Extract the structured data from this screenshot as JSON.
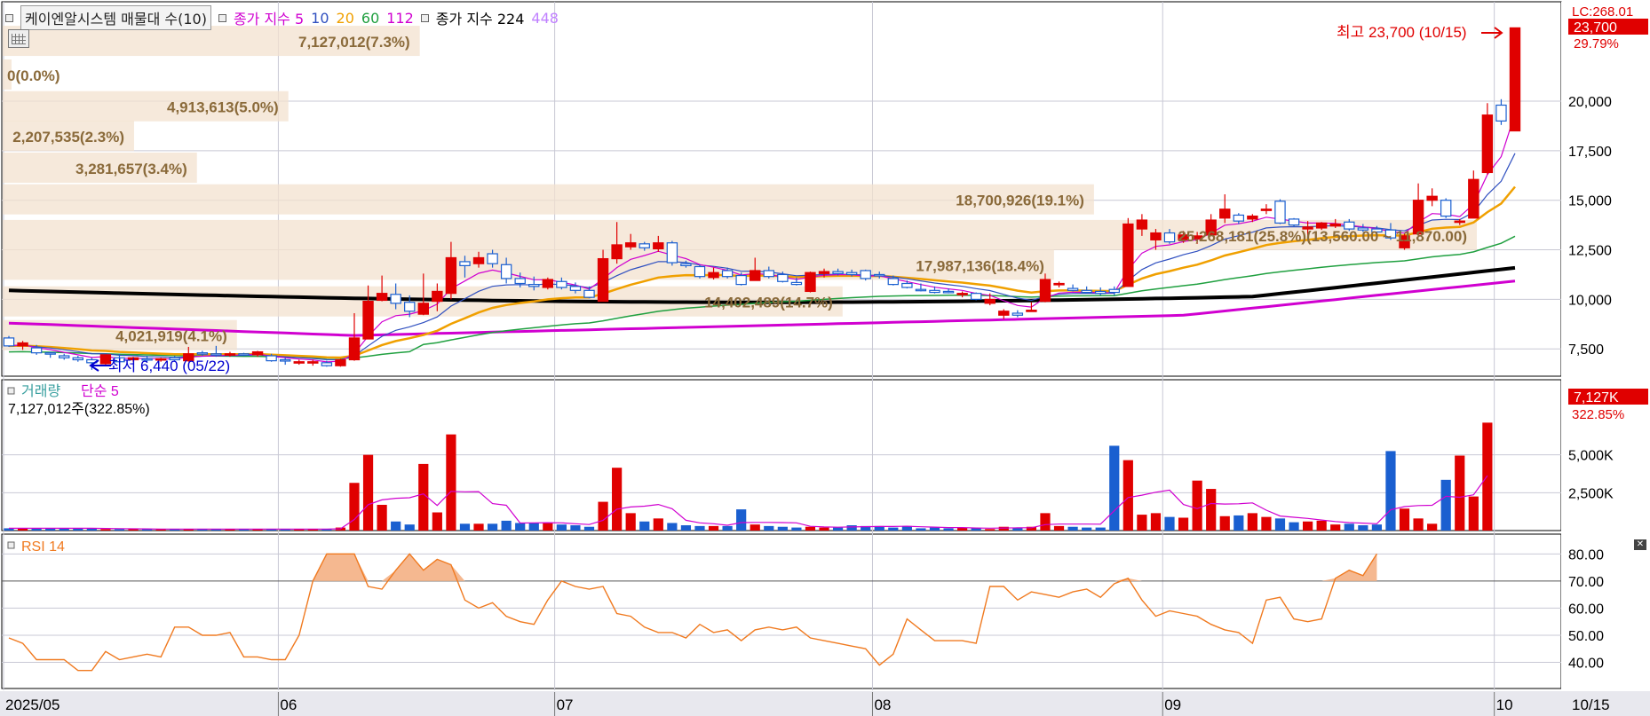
{
  "header": {
    "stock_name": "케이엔알시스템 매물대 수(10)",
    "ma_label": "종가 지수 5",
    "ma_periods": [
      "10",
      "20",
      "60",
      "112"
    ],
    "ma_colors": [
      "#d000d0",
      "#3050c0",
      "#f0a000",
      "#20a040",
      "#d000d0"
    ],
    "ma2_label": "종가 지수 224",
    "ma2_extra": "448",
    "ma2_extra_color": "#c080ff"
  },
  "price_panel": {
    "lc_label": "LC:268.01",
    "current_price": "23,700",
    "current_change": "29.79%",
    "high_annotation": "최고 23,700 (10/15)",
    "low_annotation": "최저 6,440 (05/22)",
    "y_ticks": [
      "20,000",
      "17,500",
      "15,000",
      "12,500",
      "10,000",
      "7,500"
    ],
    "y_tick_values": [
      20000,
      17500,
      15000,
      12500,
      10000,
      7500
    ]
  },
  "volume_profile": [
    {
      "label": "7,127,012(7.3%)",
      "price": 23000
    },
    {
      "label": "0(0.0%)",
      "price": 21300
    },
    {
      "label": "4,913,613(5.0%)",
      "price": 19700
    },
    {
      "label": "2,207,535(2.3%)",
      "price": 18200
    },
    {
      "label": "3,281,657(3.4%)",
      "price": 16600
    },
    {
      "label": "18,700,926(19.1%)",
      "price": 15000
    },
    {
      "label": "25,268,181(25.8%)(13,560.00 ~ 11,870.00)",
      "price": 13200
    },
    {
      "label": "17,987,136(18.4%)",
      "price": 11700
    },
    {
      "label": "14,402,489(14.7%)",
      "price": 9850
    },
    {
      "label": "4,021,919(4.1%)",
      "price": 8150
    }
  ],
  "volume_panel": {
    "title": "거래량",
    "ma_label": "단순 5",
    "info": "7,127,012주(322.85%)",
    "current_value": "7,127K",
    "current_pct": "322.85%",
    "y_ticks": [
      "5,000K",
      "2,500K"
    ],
    "y_tick_values": [
      5000,
      2500
    ]
  },
  "rsi_panel": {
    "title": "RSI 14",
    "y_ticks": [
      "80.00",
      "70.00",
      "60.00",
      "50.00",
      "40.00"
    ],
    "y_tick_values": [
      80,
      70,
      60,
      50,
      40
    ],
    "signal_line": 70
  },
  "x_axis": {
    "labels": [
      "2025/05",
      "06",
      "07",
      "08",
      "09",
      "10",
      "10/15"
    ]
  },
  "chart_data": {
    "type": "candlestick",
    "title": "케이엔알시스템",
    "xlabel": "",
    "ylabel": "",
    "price_ylim": [
      6300,
      24300
    ],
    "volume_ylim": [
      0,
      7500
    ],
    "rsi_ylim": [
      31,
      86
    ],
    "grid": true,
    "candles": [
      {
        "o": 8050,
        "h": 8150,
        "l": 7600,
        "c": 7650
      },
      {
        "o": 7650,
        "h": 7900,
        "l": 7450,
        "c": 7800
      },
      {
        "o": 7550,
        "h": 7700,
        "l": 7200,
        "c": 7300
      },
      {
        "o": 7300,
        "h": 7350,
        "l": 7050,
        "c": 7250
      },
      {
        "o": 7150,
        "h": 7250,
        "l": 6950,
        "c": 7050
      },
      {
        "o": 7050,
        "h": 7150,
        "l": 6850,
        "c": 6950
      },
      {
        "o": 6950,
        "h": 7050,
        "l": 6440,
        "c": 6800
      },
      {
        "o": 6750,
        "h": 7200,
        "l": 6700,
        "c": 7200
      },
      {
        "o": 7050,
        "h": 7250,
        "l": 6800,
        "c": 6850
      },
      {
        "o": 6950,
        "h": 7100,
        "l": 6850,
        "c": 7050
      },
      {
        "o": 7000,
        "h": 7150,
        "l": 6850,
        "c": 6950
      },
      {
        "o": 6950,
        "h": 7050,
        "l": 6850,
        "c": 7000
      },
      {
        "o": 7050,
        "h": 7150,
        "l": 6900,
        "c": 6950
      },
      {
        "o": 6900,
        "h": 7600,
        "l": 6850,
        "c": 7250
      },
      {
        "o": 7300,
        "h": 7400,
        "l": 7150,
        "c": 7250
      },
      {
        "o": 7250,
        "h": 7650,
        "l": 7100,
        "c": 7200
      },
      {
        "o": 7200,
        "h": 7350,
        "l": 7100,
        "c": 7250
      },
      {
        "o": 7250,
        "h": 7300,
        "l": 7150,
        "c": 7200
      },
      {
        "o": 7200,
        "h": 7400,
        "l": 7100,
        "c": 7350
      },
      {
        "o": 7150,
        "h": 7250,
        "l": 6850,
        "c": 6900
      },
      {
        "o": 6950,
        "h": 7050,
        "l": 6700,
        "c": 6900
      },
      {
        "o": 6850,
        "h": 6950,
        "l": 6700,
        "c": 6850
      },
      {
        "o": 6850,
        "h": 6950,
        "l": 6650,
        "c": 6850
      },
      {
        "o": 6800,
        "h": 6900,
        "l": 6600,
        "c": 6650
      },
      {
        "o": 6650,
        "h": 7000,
        "l": 6600,
        "c": 6950
      },
      {
        "o": 6950,
        "h": 9300,
        "l": 6900,
        "c": 8050
      },
      {
        "o": 8000,
        "h": 10700,
        "l": 8000,
        "c": 9900
      },
      {
        "o": 9950,
        "h": 11200,
        "l": 9900,
        "c": 10300
      },
      {
        "o": 10250,
        "h": 10800,
        "l": 9500,
        "c": 9800
      },
      {
        "o": 9850,
        "h": 10200,
        "l": 9100,
        "c": 9400
      },
      {
        "o": 9250,
        "h": 11300,
        "l": 9200,
        "c": 9800
      },
      {
        "o": 9900,
        "h": 10800,
        "l": 9400,
        "c": 10400
      },
      {
        "o": 10300,
        "h": 12900,
        "l": 10000,
        "c": 12100
      },
      {
        "o": 11900,
        "h": 12200,
        "l": 11100,
        "c": 11700
      },
      {
        "o": 11800,
        "h": 12400,
        "l": 11600,
        "c": 12100
      },
      {
        "o": 12300,
        "h": 12500,
        "l": 11600,
        "c": 11800
      },
      {
        "o": 11750,
        "h": 12100,
        "l": 10800,
        "c": 11050
      },
      {
        "o": 11050,
        "h": 11350,
        "l": 10600,
        "c": 10800
      },
      {
        "o": 10750,
        "h": 11150,
        "l": 10450,
        "c": 10650
      },
      {
        "o": 10600,
        "h": 11100,
        "l": 10500,
        "c": 11000
      },
      {
        "o": 10900,
        "h": 11100,
        "l": 10500,
        "c": 10600
      },
      {
        "o": 10650,
        "h": 10850,
        "l": 10300,
        "c": 10450
      },
      {
        "o": 10450,
        "h": 10650,
        "l": 10050,
        "c": 10100
      },
      {
        "o": 9900,
        "h": 12500,
        "l": 9900,
        "c": 12050
      },
      {
        "o": 12050,
        "h": 13900,
        "l": 11800,
        "c": 12750
      },
      {
        "o": 12650,
        "h": 13300,
        "l": 12500,
        "c": 12850
      },
      {
        "o": 12800,
        "h": 12900,
        "l": 12450,
        "c": 12600
      },
      {
        "o": 12550,
        "h": 13200,
        "l": 12400,
        "c": 12850
      },
      {
        "o": 12850,
        "h": 12950,
        "l": 11700,
        "c": 11850
      },
      {
        "o": 11800,
        "h": 11950,
        "l": 11600,
        "c": 11700
      },
      {
        "o": 11650,
        "h": 11750,
        "l": 11050,
        "c": 11150
      },
      {
        "o": 11100,
        "h": 11600,
        "l": 11000,
        "c": 11350
      },
      {
        "o": 11450,
        "h": 11600,
        "l": 11050,
        "c": 11150
      },
      {
        "o": 11200,
        "h": 11350,
        "l": 10700,
        "c": 10750
      },
      {
        "o": 10950,
        "h": 12100,
        "l": 10950,
        "c": 11450
      },
      {
        "o": 11450,
        "h": 11650,
        "l": 11050,
        "c": 11150
      },
      {
        "o": 11250,
        "h": 11400,
        "l": 10850,
        "c": 10900
      },
      {
        "o": 10850,
        "h": 11100,
        "l": 10700,
        "c": 10750
      },
      {
        "o": 10400,
        "h": 11400,
        "l": 10350,
        "c": 11350
      },
      {
        "o": 11300,
        "h": 11550,
        "l": 11100,
        "c": 11400
      },
      {
        "o": 11400,
        "h": 11550,
        "l": 11200,
        "c": 11300
      },
      {
        "o": 11350,
        "h": 11500,
        "l": 11150,
        "c": 11250
      },
      {
        "o": 11450,
        "h": 11500,
        "l": 10950,
        "c": 11050
      },
      {
        "o": 11250,
        "h": 11400,
        "l": 11050,
        "c": 11200
      },
      {
        "o": 11050,
        "h": 11200,
        "l": 10700,
        "c": 10750
      },
      {
        "o": 10800,
        "h": 10950,
        "l": 10550,
        "c": 10600
      },
      {
        "o": 10500,
        "h": 10800,
        "l": 10400,
        "c": 10450
      },
      {
        "o": 10450,
        "h": 10650,
        "l": 10300,
        "c": 10350
      },
      {
        "o": 10400,
        "h": 10550,
        "l": 10300,
        "c": 10350
      },
      {
        "o": 10300,
        "h": 10400,
        "l": 10100,
        "c": 10300
      },
      {
        "o": 10300,
        "h": 10350,
        "l": 9950,
        "c": 10000
      },
      {
        "o": 9800,
        "h": 10300,
        "l": 9700,
        "c": 10000
      },
      {
        "o": 9200,
        "h": 9500,
        "l": 9000,
        "c": 9400
      },
      {
        "o": 9300,
        "h": 9450,
        "l": 9100,
        "c": 9200
      },
      {
        "o": 9450,
        "h": 9850,
        "l": 9400,
        "c": 9450
      },
      {
        "o": 9900,
        "h": 11300,
        "l": 9850,
        "c": 11000
      },
      {
        "o": 10750,
        "h": 10900,
        "l": 10600,
        "c": 10800
      },
      {
        "o": 10550,
        "h": 10750,
        "l": 10400,
        "c": 10450
      },
      {
        "o": 10450,
        "h": 10650,
        "l": 10300,
        "c": 10350
      },
      {
        "o": 10400,
        "h": 10600,
        "l": 10200,
        "c": 10300
      },
      {
        "o": 10500,
        "h": 10650,
        "l": 10200,
        "c": 10350
      },
      {
        "o": 10650,
        "h": 14100,
        "l": 10650,
        "c": 13800
      },
      {
        "o": 13550,
        "h": 14300,
        "l": 13200,
        "c": 14000
      },
      {
        "o": 13000,
        "h": 13550,
        "l": 12500,
        "c": 13350
      },
      {
        "o": 13350,
        "h": 13550,
        "l": 12800,
        "c": 12900
      },
      {
        "o": 13000,
        "h": 13450,
        "l": 12850,
        "c": 13250
      },
      {
        "o": 13050,
        "h": 13400,
        "l": 12800,
        "c": 13200
      },
      {
        "o": 13250,
        "h": 14300,
        "l": 13250,
        "c": 14000
      },
      {
        "o": 14100,
        "h": 15300,
        "l": 13850,
        "c": 14550
      },
      {
        "o": 14250,
        "h": 14350,
        "l": 13800,
        "c": 13950
      },
      {
        "o": 14050,
        "h": 14300,
        "l": 13900,
        "c": 14200
      },
      {
        "o": 14550,
        "h": 14800,
        "l": 14300,
        "c": 14550
      },
      {
        "o": 14950,
        "h": 15050,
        "l": 13800,
        "c": 13850
      },
      {
        "o": 14050,
        "h": 14100,
        "l": 13650,
        "c": 13750
      },
      {
        "o": 13550,
        "h": 13950,
        "l": 13200,
        "c": 13650
      },
      {
        "o": 13600,
        "h": 13900,
        "l": 13500,
        "c": 13850
      },
      {
        "o": 13700,
        "h": 14050,
        "l": 13600,
        "c": 13800
      },
      {
        "o": 13900,
        "h": 14050,
        "l": 13450,
        "c": 13550
      },
      {
        "o": 13600,
        "h": 13800,
        "l": 13400,
        "c": 13500
      },
      {
        "o": 13550,
        "h": 13700,
        "l": 13300,
        "c": 13400
      },
      {
        "o": 13500,
        "h": 13850,
        "l": 13000,
        "c": 13100
      },
      {
        "o": 12600,
        "h": 13300,
        "l": 12500,
        "c": 13200
      },
      {
        "o": 13300,
        "h": 15850,
        "l": 13200,
        "c": 15000
      },
      {
        "o": 15000,
        "h": 15600,
        "l": 14700,
        "c": 15200
      },
      {
        "o": 15000,
        "h": 15100,
        "l": 14100,
        "c": 14200
      },
      {
        "o": 13900,
        "h": 14050,
        "l": 13750,
        "c": 13950
      },
      {
        "o": 14100,
        "h": 16500,
        "l": 14100,
        "c": 16050
      },
      {
        "o": 16400,
        "h": 19900,
        "l": 16300,
        "c": 19300
      },
      {
        "o": 19800,
        "h": 20100,
        "l": 18800,
        "c": 19000
      },
      {
        "o": 18500,
        "h": 23700,
        "l": 18500,
        "c": 23700
      }
    ],
    "volume_k": [
      150,
      150,
      150,
      150,
      150,
      150,
      150,
      100,
      100,
      100,
      100,
      100,
      100,
      100,
      100,
      100,
      100,
      100,
      100,
      100,
      100,
      100,
      100,
      100,
      200,
      3150,
      5000,
      1700,
      600,
      400,
      4400,
      1200,
      6350,
      450,
      450,
      450,
      650,
      500,
      500,
      500,
      400,
      350,
      250,
      1900,
      4150,
      1150,
      600,
      800,
      500,
      350,
      300,
      300,
      300,
      1400,
      400,
      300,
      250,
      200,
      250,
      200,
      200,
      350,
      300,
      300,
      200,
      300,
      150,
      200,
      150,
      200,
      150,
      100,
      250,
      200,
      250,
      1150,
      300,
      250,
      200,
      200,
      5600,
      4650,
      1050,
      1150,
      900,
      850,
      3300,
      2750,
      950,
      1000,
      1150,
      900,
      800,
      550,
      600,
      650,
      400,
      450,
      350,
      400,
      5250,
      1450,
      800,
      450,
      3350,
      4950,
      2250,
      7127
    ],
    "rsi": [
      49,
      47,
      41,
      41,
      41,
      37,
      37,
      44,
      41,
      42,
      43,
      42,
      53,
      53,
      50,
      50,
      51,
      42,
      42,
      41,
      41,
      50,
      70,
      80,
      80,
      80,
      68,
      67,
      74,
      80,
      74,
      78,
      76,
      63,
      60,
      62,
      57,
      55,
      54,
      63,
      70,
      68,
      67,
      68,
      58,
      57,
      53,
      51,
      51,
      49,
      54,
      51,
      52,
      48,
      52,
      53,
      52,
      53,
      49,
      48,
      47,
      46,
      45,
      39,
      43,
      56,
      52,
      48,
      48,
      48,
      47,
      68,
      68,
      63,
      66,
      65,
      64,
      66,
      67,
      64,
      69,
      71,
      63,
      57,
      59,
      58,
      57,
      54,
      52,
      51,
      47,
      63,
      64,
      56,
      55,
      56,
      71,
      74,
      72,
      80
    ]
  }
}
